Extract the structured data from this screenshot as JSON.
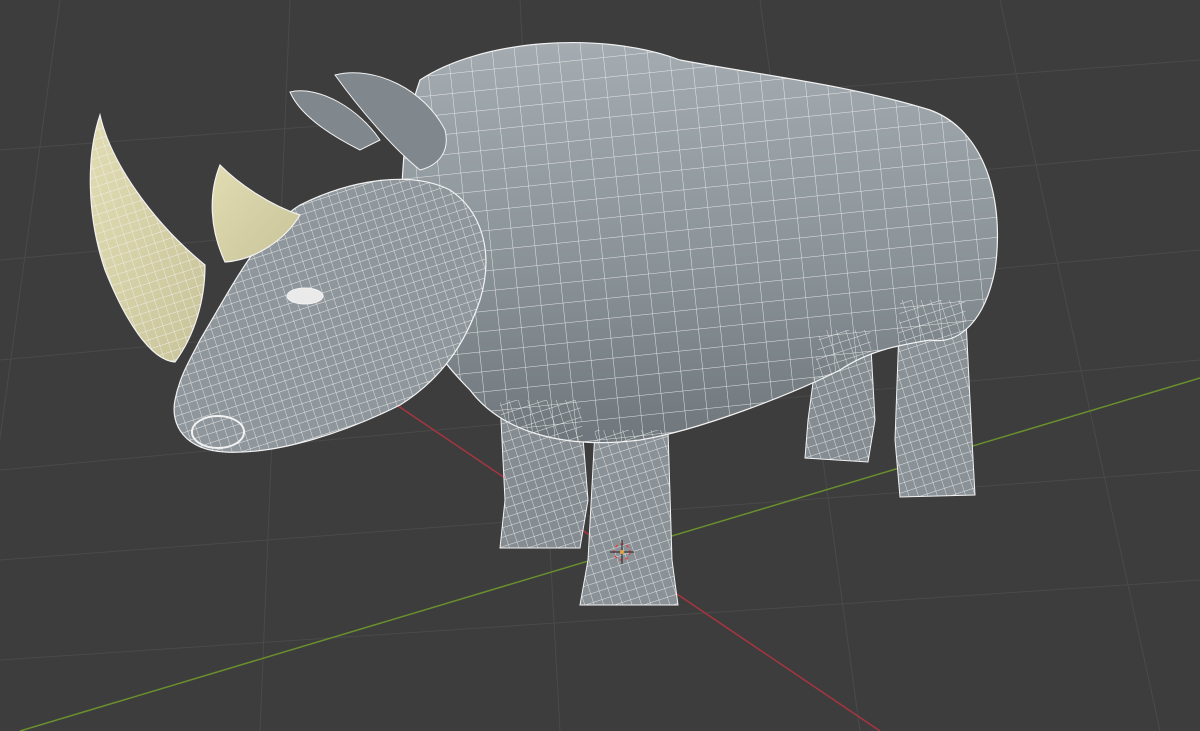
{
  "viewport": {
    "background_color": "#3d3d3d",
    "grid_color": "#4a4a4a",
    "x_axis_color": "#a8353f",
    "y_axis_color": "#6a8f2d"
  },
  "model": {
    "body_color": "#8e979c",
    "horn_color": "#d8d2a6",
    "wire_color": "#f2f2f2",
    "selection": "front-horn"
  },
  "icons": {
    "origin": "3d-cursor-icon"
  }
}
